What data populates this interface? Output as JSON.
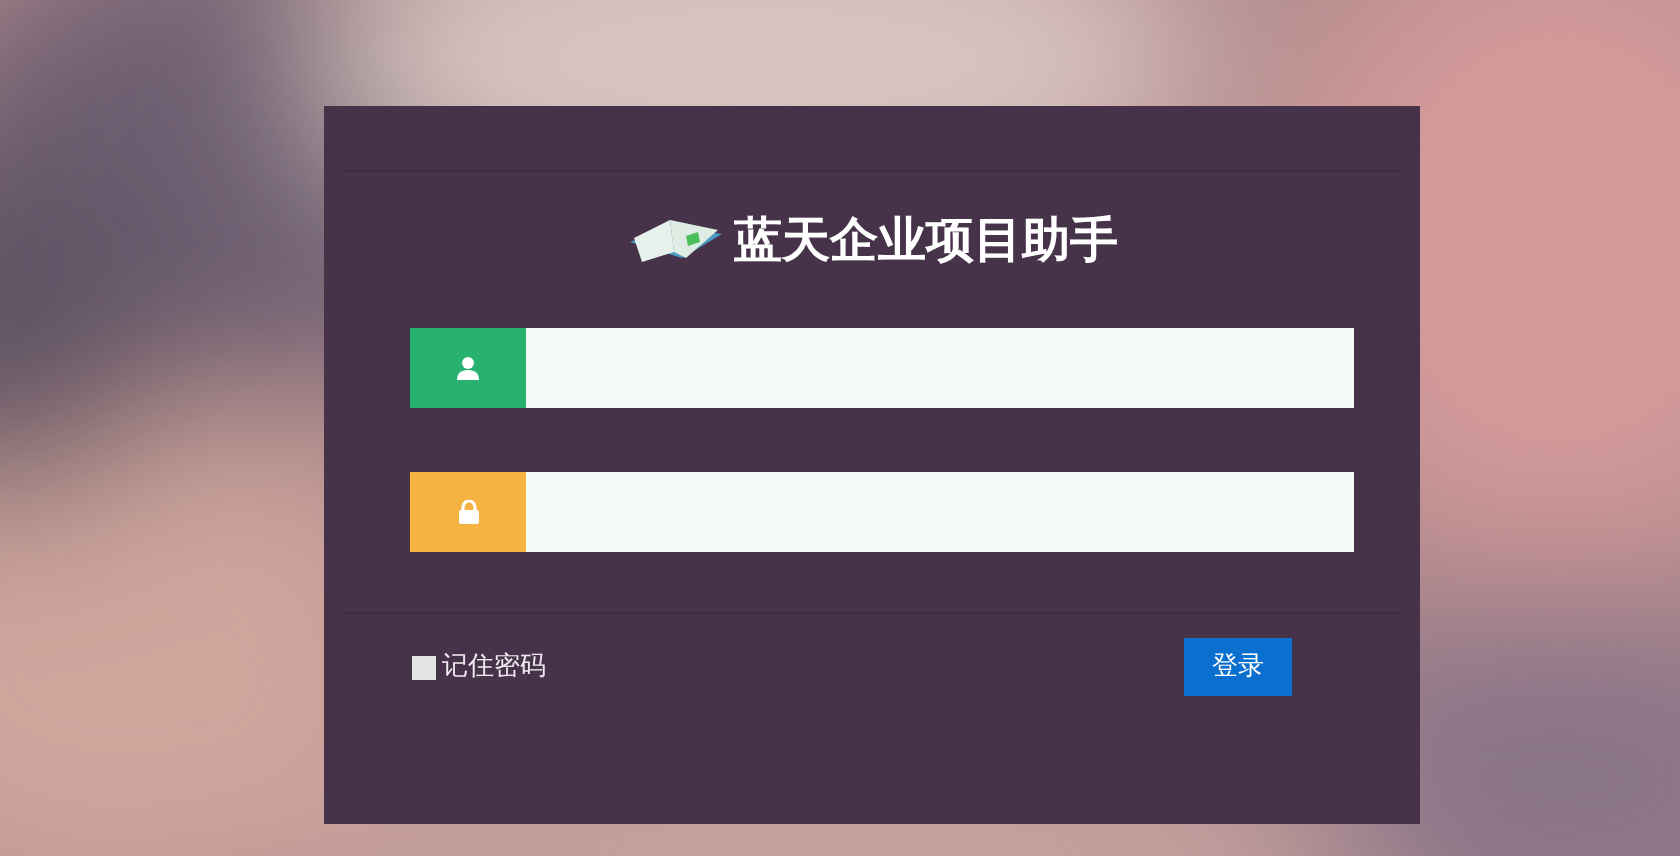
{
  "title": "蓝天企业项目助手",
  "fields": [
    {
      "kind": "user"
    },
    {
      "kind": "password"
    }
  ],
  "remember": {
    "label": "记住密码",
    "checked": false
  },
  "login_button": "登录"
}
